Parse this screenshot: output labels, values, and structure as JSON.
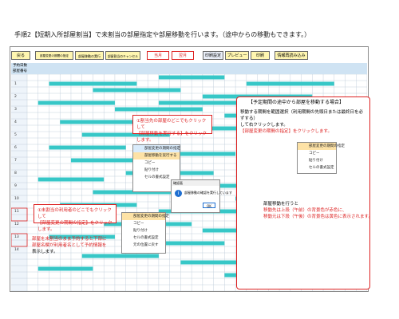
{
  "title": "手順2【短期入所部屋割当】で未割当の部屋指定や部屋移動を行います。（途中からの移動もできます。）",
  "toolbar": {
    "back": "戻る",
    "b1": "部屋変更の期間の指定",
    "b2": "部屋移動の実行",
    "b3": "部屋割当のキャンセル",
    "month_prev": "当月",
    "month_next": "翌月",
    "print_setup": "印刷設定",
    "preview": "プレビュー",
    "print": "印刷",
    "load_info": "情報再読み込み"
  },
  "header": {
    "date_label": "予約日数",
    "room_label": "部屋番号"
  },
  "rooms": [
    "1",
    "2",
    "3",
    "4",
    "5",
    "6",
    "7",
    "8",
    "9",
    "10",
    "11",
    "12",
    "13",
    "14"
  ],
  "callouts": {
    "c1_l1": "①割当先の部屋のどこでもクリックして",
    "c1_l2": "【部屋移動を実行する】をクリックします。",
    "c2_l1": "①未割当の利用者のどこでもクリックして",
    "c2_l2": "【部屋変更の期間の指定】をクリックします。",
    "c3_l1": "部屋を未割当のまま予約すると下部に",
    "c3_l2": "部屋名欄が利用者名として予約情報を",
    "c3_l3": "表示します。",
    "panel_title": "【予定期間の途中から部屋を移動する場合】",
    "p1_l1": "移動する期間を範囲選択（利用期間の先頭日または最終日を必ずする）",
    "p1_l2": "して右クリックします。",
    "p1_l3": "【部屋変更の期間の指定】をクリックします。",
    "p2_l1": "部屋移動を行うと",
    "p2_l2": "移動先は上段（午前）の背景色が赤色に、",
    "p2_l3": "移動元は下段（午後）の背景色は黄色に表示されます。"
  },
  "dialog": {
    "title": "確認画",
    "message": "部屋移動の確認を実行しています",
    "ok": "OK"
  },
  "context_menu": {
    "items": [
      "部屋変更の期間の指定",
      "部屋移動を実行する",
      "コピー",
      "貼り付け",
      "セルの書式設定"
    ],
    "sub_items": [
      "部屋変更の期間の指定",
      "部屋変更を実行する",
      "コピー",
      "貼り付け",
      "セルの書式設定",
      "元の位置に戻す"
    ]
  },
  "colors": {
    "booking": "#37c7c7",
    "header": "#cfe3f3",
    "callout_border": "#d22222"
  }
}
